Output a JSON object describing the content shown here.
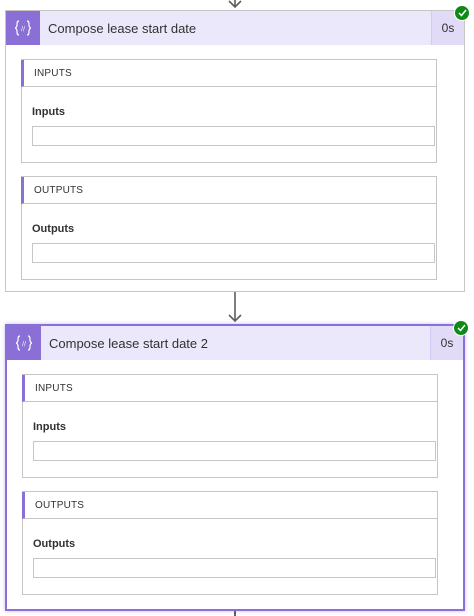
{
  "steps": [
    {
      "title": "Compose lease start date",
      "duration": "0s",
      "status_icon": "check-circle-icon",
      "action_icon": "compose-braces-icon",
      "inputs": {
        "section_title": "INPUTS",
        "field_label": "Inputs",
        "value": ""
      },
      "outputs": {
        "section_title": "OUTPUTS",
        "field_label": "Outputs",
        "value": ""
      }
    },
    {
      "title": "Compose lease start date 2",
      "duration": "0s",
      "status_icon": "check-circle-icon",
      "action_icon": "compose-braces-icon",
      "inputs": {
        "section_title": "INPUTS",
        "field_label": "Inputs",
        "value": ""
      },
      "outputs": {
        "section_title": "OUTPUTS",
        "field_label": "Outputs",
        "value": ""
      }
    }
  ],
  "colors": {
    "accent": "#8a70d6",
    "header_bg": "#ece8fb",
    "success": "#0e8a16"
  }
}
